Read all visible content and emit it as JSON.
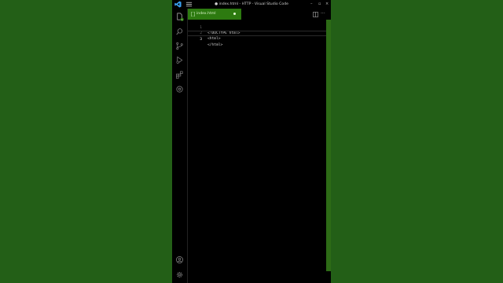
{
  "window": {
    "title": "● index.html - HTTP - Visual Studio Code",
    "controls": {
      "minimize": "–",
      "maximize": "▫",
      "close": "×"
    }
  },
  "activitybar": {
    "items": [
      {
        "name": "explorer-icon",
        "badge": "1"
      },
      {
        "name": "search-icon"
      },
      {
        "name": "source-control-icon"
      },
      {
        "name": "run-debug-icon"
      },
      {
        "name": "extensions-icon"
      },
      {
        "name": "remote-icon"
      }
    ],
    "bottom": [
      {
        "name": "account-icon"
      },
      {
        "name": "settings-gear-icon"
      }
    ]
  },
  "tabs": [
    {
      "label": "index.html",
      "modified": true,
      "active": true
    }
  ],
  "editor": {
    "lines": [
      {
        "num": "1",
        "text": "<!DOCTYPE html>"
      },
      {
        "num": "2",
        "text": "<html>"
      },
      {
        "num": "3",
        "text": "</html>"
      }
    ],
    "current_line": 3
  },
  "colors": {
    "background": "#235f17",
    "tab_active": "#2d7a10",
    "editor_bg": "#000000",
    "vscode_logo": "#3aa0f0"
  }
}
